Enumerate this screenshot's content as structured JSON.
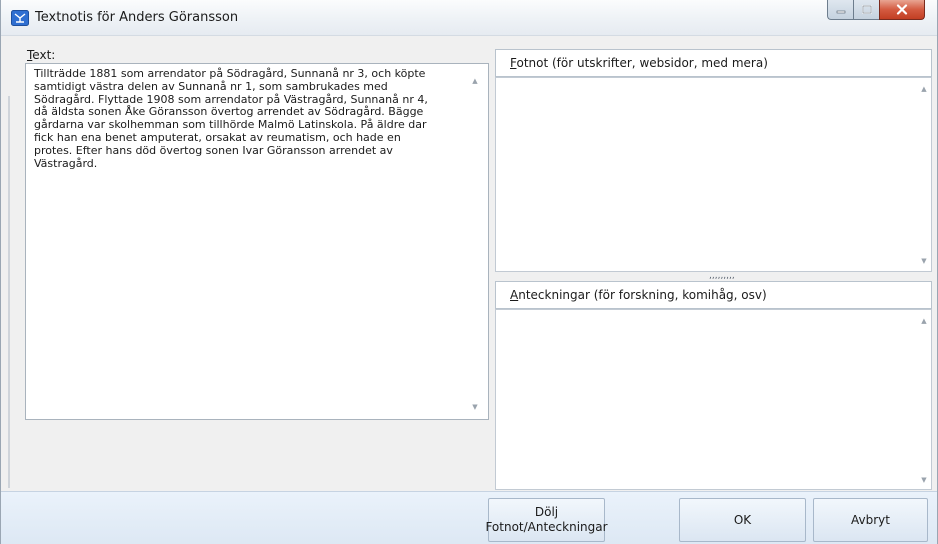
{
  "window": {
    "title": "Textnotis för Anders Göransson",
    "icon": "family-tree-icon"
  },
  "text_section": {
    "label_first": "T",
    "label_rest": "ext:",
    "content": "Tillträdde 1881 som arrendator på Södragård, Sunnanå nr 3, och köpte\nsamtidigt västra delen av Sunnanå nr 1, som sambrukades med\nSödragård. Flyttade 1908 som arrendator på Västragård, Sunnanå nr 4,\ndå äldsta sonen Åke Göransson övertog arrendet av Södragård. Bägge\ngårdarna var skolhemman som tillhörde Malmö Latinskola. På äldre dar\nfick han ena benet amputerat, orsakat av reumatism, och hade en\nprotes. Efter hans död övertog sonen Ivar Göransson arrendet av\nVästragård."
  },
  "footnote_section": {
    "label_first": "F",
    "label_rest": "otnot (för utskrifter, websidor, med mera)",
    "content": ""
  },
  "notes_section": {
    "label_first": "A",
    "label_rest": "nteckningar (för forskning, komihåg, osv)",
    "content": ""
  },
  "buttons": {
    "hide_line1": "Dölj",
    "hide_line2": "Fotnot/Anteckningar",
    "ok": "OK",
    "cancel": "Avbryt"
  },
  "colors": {
    "close_button": "#c23e23",
    "bottom_bar": "#dde8f4",
    "border": "#a9b3bd"
  }
}
